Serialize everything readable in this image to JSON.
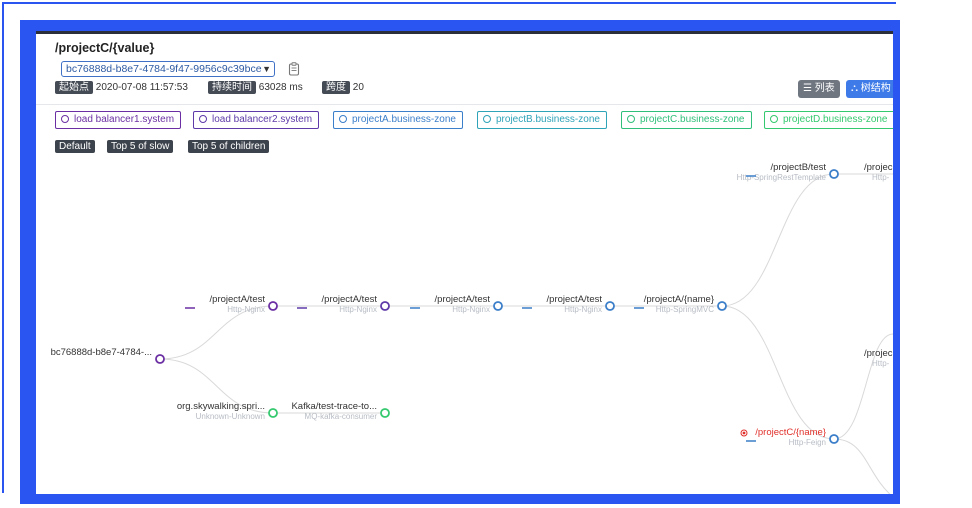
{
  "header": {
    "title": "/projectC/{value}",
    "trace_id": "bc76888d-b8e7-4784-9f47-9956c9c39bce",
    "start_label": "起始点",
    "start_value": "2020-07-08 11:57:53",
    "duration_label": "持续时间",
    "duration_value": "63028 ms",
    "span_label": "跨度",
    "span_value": "20"
  },
  "view_buttons": {
    "list": "列表",
    "tree": "树结构"
  },
  "services": [
    {
      "label": "load balancer1.system",
      "color": "#6b2fa3"
    },
    {
      "label": "load balancer2.system",
      "color": "#5d3aa8"
    },
    {
      "label": "projectA.business-zone",
      "color": "#3b7ec9"
    },
    {
      "label": "projectB.business-zone",
      "color": "#2fa3b8"
    },
    {
      "label": "projectC.business-zone",
      "color": "#2fbf7a"
    },
    {
      "label": "projectD.business-zone",
      "color": "#34c96e"
    }
  ],
  "filters": [
    "Default",
    "Top 5 of slow",
    "Top 5 of children"
  ],
  "tree_nodes": {
    "root": {
      "label": "bc76888d-b8e7-4784-...",
      "sub": ""
    },
    "a1": {
      "label": "/projectA/test",
      "sub": "Http-Nginx"
    },
    "a2": {
      "label": "/projectA/test",
      "sub": "Http-Nginx"
    },
    "a3": {
      "label": "/projectA/test",
      "sub": "Http-Nginx"
    },
    "a4": {
      "label": "/projectA/test",
      "sub": "Http-Nginx"
    },
    "a5": {
      "label": "/projectA/{name}",
      "sub": "Http-SpringMVC"
    },
    "b1": {
      "label": "/projectB/test",
      "sub": "Http-SpringRestTemplate"
    },
    "b2": {
      "label": "/projec",
      "sub": "Http-"
    },
    "c1": {
      "label": "/projectC/{name}",
      "sub": "Http-Feign"
    },
    "d1": {
      "label": "/projec",
      "sub": "Http-"
    },
    "k1": {
      "label": "org.skywalking.spri...",
      "sub": "Unknown-Unknown"
    },
    "k2": {
      "label": "Kafka/test-trace-to...",
      "sub": "MQ-kafka-consumer"
    }
  },
  "icons": {
    "copy": "copy-icon",
    "list": "list-icon",
    "tree": "sitemap-icon",
    "chevron": "chevron-down-icon",
    "error": "error-dot-icon"
  }
}
